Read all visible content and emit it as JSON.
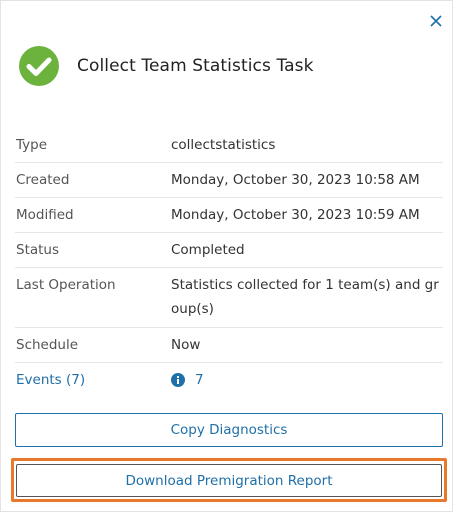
{
  "panel": {
    "title": "Collect Team Statistics Task",
    "status_color": "#6cb33e",
    "close_icon": "close-icon"
  },
  "properties": [
    {
      "label": "Type",
      "value": "collectstatistics"
    },
    {
      "label": "Created",
      "value": "Monday, October 30, 2023 10:58 AM"
    },
    {
      "label": "Modified",
      "value": "Monday, October 30, 2023 10:59 AM"
    },
    {
      "label": "Status",
      "value": "Completed"
    },
    {
      "label": "Last Operation",
      "value": "Statistics collected for 1 team(s) and group(s)"
    },
    {
      "label": "Schedule",
      "value": "Now"
    }
  ],
  "events": {
    "label": "Events (7)",
    "info_count": "7",
    "info_icon": "info-icon"
  },
  "buttons": {
    "copy_label": "Copy Diagnostics",
    "download_label": "Download Premigration Report"
  },
  "colors": {
    "link": "#1f6fa8",
    "highlight": "#e8792a",
    "success": "#6cb33e"
  }
}
